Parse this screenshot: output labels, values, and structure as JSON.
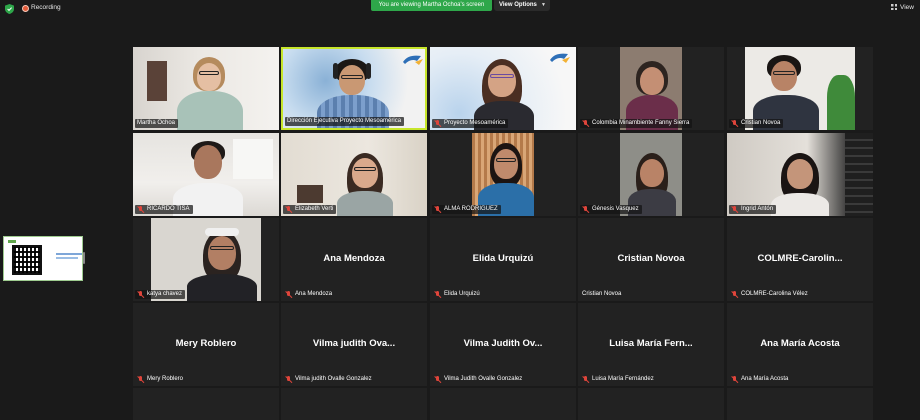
{
  "topbar": {
    "recording_label": "Recording",
    "viewing_banner": "You are viewing Martha Ochoa's screen",
    "view_options_label": "View Options",
    "view_button_label": "View"
  },
  "colors": {
    "background": "#1a1a1a",
    "tile": "#222222",
    "active_speaker_border": "#c7e62b",
    "banner_green": "#2ea74a",
    "muted_red": "#e0453b"
  },
  "participants": [
    {
      "tile_name": "Martha Ochoa",
      "muted": false,
      "video": true
    },
    {
      "tile_name": "Dirección Ejecutiva Proyecto Mesoamérica",
      "muted": false,
      "video": true,
      "active": true
    },
    {
      "tile_name": "Proyecto Mesoamérica",
      "muted": true,
      "video": true
    },
    {
      "tile_name": "Colombia Minambiente Fanny Sierra",
      "muted": true,
      "video": true
    },
    {
      "tile_name": "Cristian Novoa",
      "muted": true,
      "video": true
    },
    {
      "tile_name": "RICARDO TISA",
      "muted": true,
      "video": true
    },
    {
      "tile_name": "Elizabeth Verti",
      "muted": true,
      "video": true
    },
    {
      "tile_name": "ALMA RODRIGUEZ",
      "muted": true,
      "video": true
    },
    {
      "tile_name": "Génesis Vasquez",
      "muted": true,
      "video": true
    },
    {
      "tile_name": "Ingrid Antón",
      "muted": true,
      "video": true
    },
    {
      "tile_name": "katya chavez",
      "muted": true,
      "video": true
    },
    {
      "tile_name": "Ana Mendoza",
      "display_name": "Ana Mendoza",
      "muted": true,
      "video": false
    },
    {
      "tile_name": "Elida Urquizú",
      "display_name": "Elida Urquizú",
      "muted": true,
      "video": false
    },
    {
      "tile_name": "Cristian Novoa",
      "display_name": "Cristian Novoa",
      "muted": false,
      "video": false
    },
    {
      "tile_name": "COLMRE-Carolina Vélez",
      "display_name": "COLMRE-Carolin...",
      "muted": true,
      "video": false
    },
    {
      "tile_name": "Mery Roblero",
      "display_name": "Mery Roblero",
      "muted": true,
      "video": false
    },
    {
      "tile_name": "Vilma judith Ovalle Gonzalez",
      "display_name": "Vilma judith Ova...",
      "muted": true,
      "video": false
    },
    {
      "tile_name": "Vilma Judith Ovalle Gonzalez",
      "display_name": "Vilma Judith Ov...",
      "muted": true,
      "video": false
    },
    {
      "tile_name": "Luisa María Fernández",
      "display_name": "Luisa María Fern...",
      "muted": true,
      "video": false
    },
    {
      "tile_name": "Ana María Acosta",
      "display_name": "Ana María Acosta",
      "muted": true,
      "video": false
    }
  ]
}
